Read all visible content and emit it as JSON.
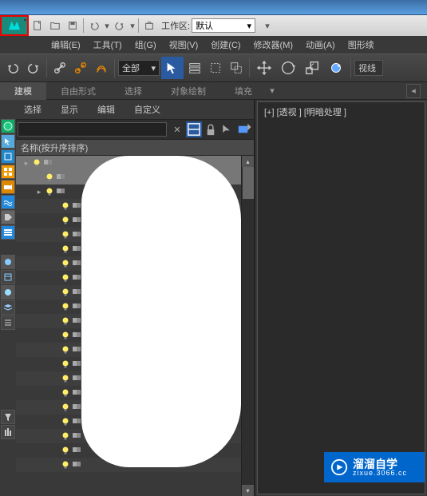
{
  "app": {
    "name": "MAX"
  },
  "qat": {
    "workspace_label": "工作区:",
    "workspace_value": "默认"
  },
  "menus": [
    "编辑(E)",
    "工具(T)",
    "组(G)",
    "视图(V)",
    "创建(C)",
    "修改器(M)",
    "动画(A)",
    "图形续"
  ],
  "toolbar": {
    "filter_value": "全部",
    "view_label": "视线"
  },
  "ribbon": {
    "tabs": [
      "建模",
      "自由形式",
      "选择",
      "对象绘制",
      "填充"
    ]
  },
  "scene_panel": {
    "tabs": [
      "选择",
      "显示",
      "编辑",
      "自定义"
    ],
    "header": "名称(按升序排序)",
    "rows": 22
  },
  "viewport": {
    "label": "[+] [透视 ] [明暗处理 ]"
  },
  "watermark": {
    "main": "溜溜自学",
    "sub": "zixue.3066.cc"
  }
}
